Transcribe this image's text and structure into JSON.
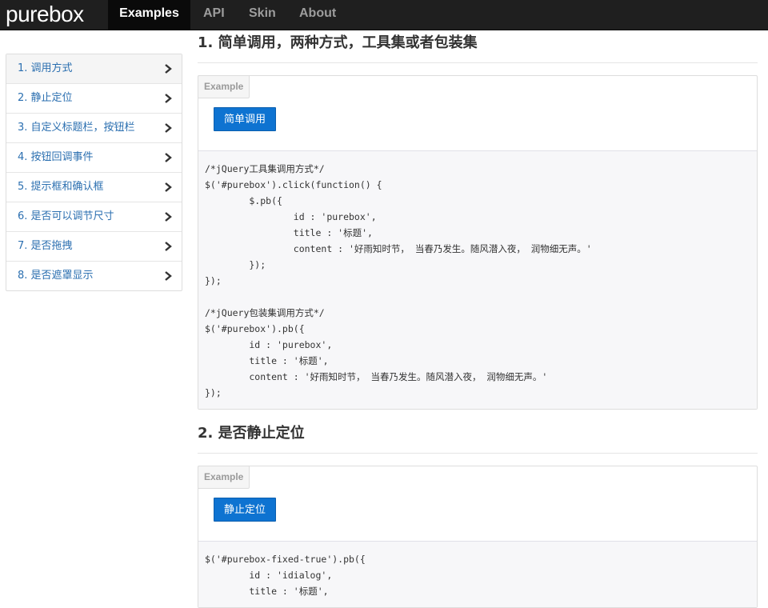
{
  "navbar": {
    "brand": "purebox",
    "items": [
      {
        "label": "Examples",
        "active": true
      },
      {
        "label": "API"
      },
      {
        "label": "Skin"
      },
      {
        "label": "About"
      }
    ]
  },
  "sidebar": {
    "items": [
      {
        "label": "1. 调用方式",
        "active": true
      },
      {
        "label": "2. 静止定位"
      },
      {
        "label": "3. 自定义标题栏，按钮栏"
      },
      {
        "label": "4. 按钮回调事件"
      },
      {
        "label": "5. 提示框和确认框"
      },
      {
        "label": "6. 是否可以调节尺寸"
      },
      {
        "label": "7. 是否拖拽"
      },
      {
        "label": "8. 是否遮罩显示"
      }
    ],
    "chevron_icon": "chevron-right-icon"
  },
  "sections": [
    {
      "title": "1. 简单调用，两种方式，工具集或者包装集",
      "example_tag": "Example",
      "button_label": "简单调用",
      "code": "/*jQuery工具集调用方式*/\n$('#purebox').click(function() {\n        $.pb({\n                id : 'purebox',\n                title : '标题',\n                content : '好雨知时节， 当春乃发生。随风潜入夜， 润物细无声。'\n        });\n});\n\n/*jQuery包装集调用方式*/\n$('#purebox').pb({\n        id : 'purebox',\n        title : '标题',\n        content : '好雨知时节， 当春乃发生。随风潜入夜， 润物细无声。'\n});"
    },
    {
      "title": "2. 是否静止定位",
      "example_tag": "Example",
      "button_label": "静止定位",
      "code": "$('#purebox-fixed-true').pb({\n        id : 'idialog',\n        title : '标题',"
    }
  ],
  "colors": {
    "navbar_bg": "#1f1f1f",
    "link": "#2b6fb0",
    "button_bg": "#0e73d1"
  }
}
